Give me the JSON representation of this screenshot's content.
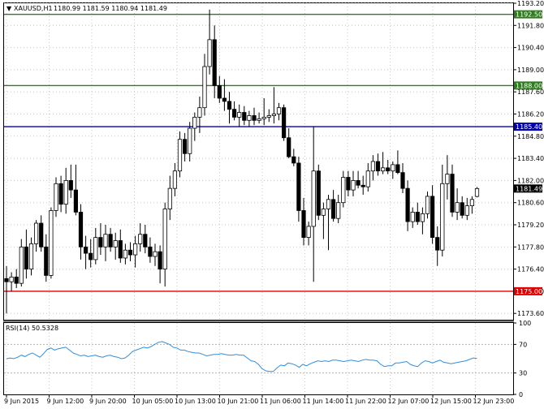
{
  "header": {
    "arrow": "▼",
    "symbol": "XAUUSD,H1",
    "ohlc": "1180.99 1181.59 1180.94 1181.49"
  },
  "rsi_header": "RSI(14) 50.5328",
  "chart_data": [
    {
      "type": "candlestick",
      "title": "XAUUSD,H1",
      "ylim": [
        1173.2,
        1193.2
      ],
      "y_ticks": [
        "1193.20",
        "1191.80",
        "1190.40",
        "1189.00",
        "1187.60",
        "1186.20",
        "1184.80",
        "1183.40",
        "1182.00",
        "1180.60",
        "1179.20",
        "1177.80",
        "1176.40",
        "1175.00",
        "1173.60"
      ],
      "x_ticks": [
        "9 Jun 2015",
        "9 Jun 12:00",
        "9 Jun 20:00",
        "10 Jun 05:00",
        "10 Jun 13:00",
        "10 Jun 21:00",
        "11 Jun 06:00",
        "11 Jun 14:00",
        "11 Jun 22:00",
        "12 Jun 07:00",
        "12 Jun 15:00",
        "12 Jun 23:00"
      ],
      "current_price": "1181.49",
      "levels": [
        {
          "price": "1192.50",
          "color": "#2e7d1e"
        },
        {
          "price": "1188.00",
          "color": "#2e7d1e"
        },
        {
          "price": "1185.40",
          "color": "#0000b0"
        },
        {
          "price": "1175.00",
          "color": "#e00000"
        }
      ],
      "ohlc": [
        [
          1175.8,
          1176.6,
          1173.6,
          1175.6
        ],
        [
          1175.6,
          1176.2,
          1175.0,
          1175.9
        ],
        [
          1175.9,
          1176.4,
          1175.2,
          1175.5
        ],
        [
          1175.5,
          1178.3,
          1175.3,
          1177.8
        ],
        [
          1177.8,
          1178.9,
          1175.8,
          1176.4
        ],
        [
          1176.4,
          1178.4,
          1176.0,
          1178.0
        ],
        [
          1178.0,
          1179.5,
          1177.5,
          1179.3
        ],
        [
          1179.3,
          1179.8,
          1177.5,
          1177.8
        ],
        [
          1177.8,
          1178.6,
          1175.6,
          1176.0
        ],
        [
          1176.0,
          1180.3,
          1175.8,
          1180.1
        ],
        [
          1180.1,
          1182.2,
          1179.7,
          1181.8
        ],
        [
          1181.8,
          1182.3,
          1180.0,
          1180.5
        ],
        [
          1180.5,
          1182.8,
          1179.9,
          1182.0
        ],
        [
          1182.0,
          1183.0,
          1180.9,
          1181.4
        ],
        [
          1181.4,
          1183.0,
          1179.8,
          1180.0
        ],
        [
          1180.0,
          1180.5,
          1177.0,
          1177.8
        ],
        [
          1177.8,
          1178.5,
          1176.4,
          1177.4
        ],
        [
          1177.4,
          1178.3,
          1176.5,
          1177.0
        ],
        [
          1177.0,
          1179.0,
          1176.7,
          1178.4
        ],
        [
          1178.4,
          1179.3,
          1177.3,
          1177.8
        ],
        [
          1177.8,
          1179.2,
          1176.9,
          1178.6
        ],
        [
          1178.6,
          1179.0,
          1177.5,
          1177.8
        ],
        [
          1177.8,
          1178.7,
          1177.0,
          1178.2
        ],
        [
          1178.2,
          1178.9,
          1176.8,
          1177.1
        ],
        [
          1177.1,
          1178.0,
          1176.7,
          1177.6
        ],
        [
          1177.6,
          1178.1,
          1176.9,
          1177.3
        ],
        [
          1177.3,
          1178.5,
          1176.5,
          1178.0
        ],
        [
          1178.0,
          1179.3,
          1177.5,
          1178.6
        ],
        [
          1178.6,
          1179.2,
          1177.4,
          1177.8
        ],
        [
          1177.8,
          1178.4,
          1176.8,
          1177.2
        ],
        [
          1177.2,
          1178.0,
          1176.6,
          1177.5
        ],
        [
          1177.5,
          1177.9,
          1175.5,
          1176.4
        ],
        [
          1176.4,
          1180.6,
          1175.3,
          1180.2
        ],
        [
          1180.2,
          1182.3,
          1179.5,
          1181.5
        ],
        [
          1181.5,
          1183.1,
          1181.0,
          1182.6
        ],
        [
          1182.6,
          1185.1,
          1182.2,
          1184.6
        ],
        [
          1184.6,
          1185.0,
          1183.2,
          1183.7
        ],
        [
          1183.7,
          1185.7,
          1183.2,
          1185.3
        ],
        [
          1185.3,
          1186.3,
          1184.5,
          1186.0
        ],
        [
          1186.0,
          1187.3,
          1185.0,
          1186.6
        ],
        [
          1186.6,
          1190.0,
          1186.1,
          1189.2
        ],
        [
          1189.2,
          1192.8,
          1188.7,
          1190.9
        ],
        [
          1190.9,
          1191.8,
          1187.2,
          1188.0
        ],
        [
          1188.0,
          1188.6,
          1186.9,
          1187.2
        ],
        [
          1187.2,
          1188.4,
          1186.4,
          1187.0
        ],
        [
          1187.0,
          1187.6,
          1185.6,
          1186.5
        ],
        [
          1186.5,
          1187.0,
          1185.8,
          1186.0
        ],
        [
          1186.0,
          1186.8,
          1185.4,
          1186.3
        ],
        [
          1186.3,
          1186.7,
          1185.5,
          1185.8
        ],
        [
          1185.8,
          1186.4,
          1185.4,
          1186.1
        ],
        [
          1186.1,
          1186.6,
          1185.5,
          1185.8
        ],
        [
          1185.8,
          1186.3,
          1185.6,
          1185.9
        ],
        [
          1185.9,
          1187.2,
          1185.5,
          1186.0
        ],
        [
          1186.0,
          1186.5,
          1185.7,
          1186.1
        ],
        [
          1186.1,
          1187.9,
          1185.6,
          1186.2
        ],
        [
          1186.2,
          1186.9,
          1185.8,
          1186.6
        ],
        [
          1186.6,
          1186.8,
          1184.5,
          1184.7
        ],
        [
          1184.7,
          1185.3,
          1183.4,
          1183.5
        ],
        [
          1183.5,
          1184.0,
          1182.9,
          1183.1
        ],
        [
          1183.1,
          1183.5,
          1179.4,
          1180.1
        ],
        [
          1180.1,
          1180.9,
          1177.9,
          1178.4
        ],
        [
          1178.4,
          1179.4,
          1177.9,
          1179.1
        ],
        [
          1179.1,
          1185.4,
          1175.6,
          1182.6
        ],
        [
          1182.6,
          1183.0,
          1179.5,
          1179.8
        ],
        [
          1179.8,
          1180.6,
          1178.3,
          1180.2
        ],
        [
          1180.2,
          1181.1,
          1177.6,
          1180.8
        ],
        [
          1180.8,
          1181.4,
          1179.4,
          1179.6
        ],
        [
          1179.6,
          1181.1,
          1179.3,
          1180.6
        ],
        [
          1180.6,
          1182.6,
          1180.3,
          1182.2
        ],
        [
          1182.2,
          1182.6,
          1181.0,
          1181.4
        ],
        [
          1181.4,
          1182.6,
          1181.0,
          1182.0
        ],
        [
          1182.0,
          1182.6,
          1181.5,
          1181.7
        ],
        [
          1181.7,
          1182.3,
          1181.1,
          1181.6
        ],
        [
          1181.6,
          1183.1,
          1181.3,
          1182.6
        ],
        [
          1182.6,
          1183.6,
          1182.0,
          1183.2
        ],
        [
          1183.2,
          1183.7,
          1182.3,
          1182.6
        ],
        [
          1182.6,
          1183.8,
          1182.4,
          1182.8
        ],
        [
          1182.8,
          1183.3,
          1182.4,
          1182.6
        ],
        [
          1182.6,
          1183.2,
          1182.1,
          1183.0
        ],
        [
          1183.0,
          1183.9,
          1182.4,
          1182.5
        ],
        [
          1182.5,
          1183.1,
          1181.2,
          1181.5
        ],
        [
          1181.5,
          1182.0,
          1178.8,
          1179.4
        ],
        [
          1179.4,
          1180.3,
          1179.0,
          1180.0
        ],
        [
          1180.0,
          1180.6,
          1179.2,
          1179.4
        ],
        [
          1179.4,
          1180.3,
          1178.6,
          1179.9
        ],
        [
          1179.9,
          1181.3,
          1179.6,
          1181.0
        ],
        [
          1181.0,
          1181.7,
          1178.0,
          1178.4
        ],
        [
          1178.4,
          1179.1,
          1176.6,
          1177.6
        ],
        [
          1177.6,
          1183.0,
          1177.2,
          1181.8
        ],
        [
          1181.8,
          1183.6,
          1180.8,
          1182.4
        ],
        [
          1182.4,
          1183.0,
          1179.7,
          1180.0
        ],
        [
          1180.0,
          1181.5,
          1179.5,
          1180.6
        ],
        [
          1180.6,
          1181.0,
          1179.6,
          1179.8
        ],
        [
          1179.8,
          1180.9,
          1179.5,
          1180.4
        ],
        [
          1180.4,
          1181.0,
          1179.9,
          1180.8
        ],
        [
          1180.99,
          1181.59,
          1180.94,
          1181.49
        ]
      ]
    },
    {
      "type": "line",
      "title": "RSI(14) 50.5328",
      "ylim": [
        0,
        100
      ],
      "y_ticks": [
        "100",
        "70",
        "30",
        "0"
      ],
      "levels": [
        70,
        30
      ],
      "values": [
        50,
        51,
        50,
        52,
        55,
        53,
        56,
        58,
        55,
        52,
        57,
        63,
        65,
        62,
        64,
        65,
        66,
        62,
        58,
        56,
        54,
        55,
        53,
        54,
        55,
        53,
        52,
        54,
        55,
        53,
        52,
        50,
        51,
        55,
        60,
        62,
        64,
        66,
        65,
        67,
        70,
        73,
        74,
        72,
        70,
        66,
        65,
        62,
        62,
        60,
        59,
        58,
        58,
        56,
        54,
        55,
        56,
        56,
        57,
        56,
        55,
        55,
        56,
        55,
        55,
        51,
        47,
        46,
        42,
        36,
        33,
        32,
        32,
        37,
        41,
        40,
        44,
        43,
        41,
        38,
        42,
        40,
        43,
        45,
        47,
        46,
        47,
        46,
        48,
        48,
        47,
        46,
        47,
        48,
        47,
        46,
        48,
        49,
        48,
        48,
        47,
        42,
        39,
        40,
        40,
        44,
        44,
        45,
        46,
        42,
        40,
        39,
        44,
        47,
        46,
        44,
        46,
        48,
        45,
        44,
        43,
        44,
        45,
        46,
        47,
        49,
        51,
        50.5
      ]
    }
  ]
}
